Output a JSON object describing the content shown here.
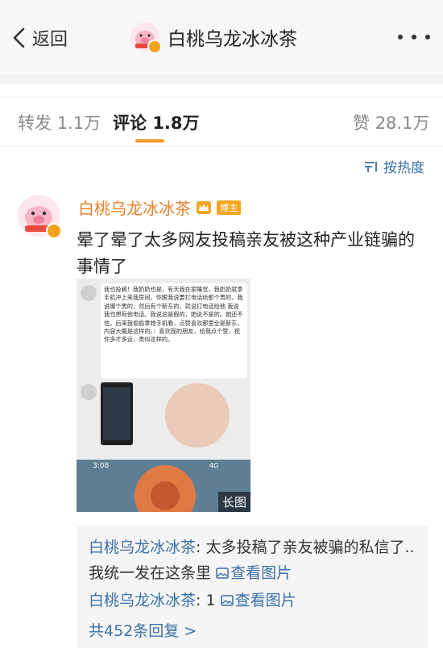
{
  "nav": {
    "back_label": "返回",
    "title": "白桃乌龙冰冰茶"
  },
  "tabs": [
    {
      "label": "转发",
      "count": "1.1万"
    },
    {
      "label": "评论",
      "count": "1.8万"
    },
    {
      "label": "赞",
      "count": "28.1万"
    }
  ],
  "sort_label": "按热度",
  "comment": {
    "author": "白桃乌龙冰冰茶",
    "badge": "博主",
    "text": "晕了晕了太多网友投稿亲友被这种产业链骗的事情了",
    "image": {
      "chat_text": "我也投稿！我奶奶也是，有天我在家睡觉，我奶奶就拿手机冲上来我房间，你跟我说要打电话给那个男的，我说哪个男的，然后有个新东的，就说打电话给他 我说我也想有他电话。我说这是假的，她说不是的。她还不信。后来我偷偷拿她手机看，点赞喜欢那里全是新东，内容大概是这样的，：喜欢我的朋友，给我点个赞，祝你多才多运，类似这样的。",
      "status_time": "3:08",
      "status_signal": "4G",
      "long_badge": "长图"
    }
  },
  "replies": [
    {
      "author": "白桃乌龙冰冰茶",
      "text": ": 太多投稿了亲友被骗的私信了..我统一发在这条里",
      "link": "查看图片"
    },
    {
      "author": "白桃乌龙冰冰茶",
      "text": ": 1",
      "link": "查看图片"
    }
  ],
  "more_replies": "共452条回复 >",
  "colors": {
    "accent": "#f79a28",
    "link": "#3a6fa6",
    "name": "#e7832a"
  }
}
